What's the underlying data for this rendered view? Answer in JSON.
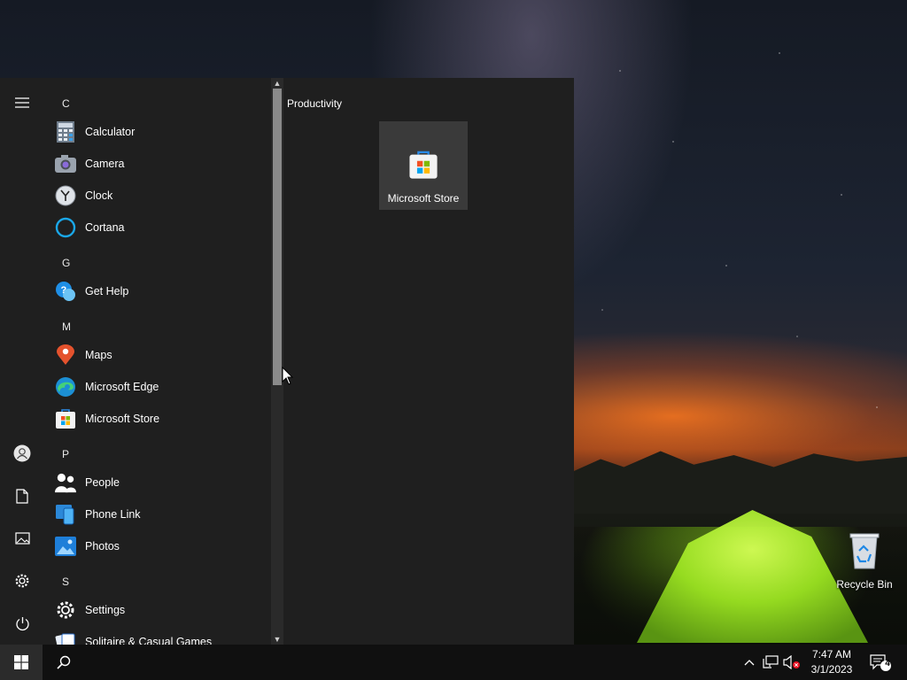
{
  "start_menu": {
    "app_list": [
      {
        "type": "letter",
        "text": "C"
      },
      {
        "type": "app",
        "label": "Calculator",
        "icon": "calculator-icon"
      },
      {
        "type": "app",
        "label": "Camera",
        "icon": "camera-icon"
      },
      {
        "type": "app",
        "label": "Clock",
        "icon": "clock-icon"
      },
      {
        "type": "app",
        "label": "Cortana",
        "icon": "cortana-icon"
      },
      {
        "type": "letter",
        "text": "G"
      },
      {
        "type": "app",
        "label": "Get Help",
        "icon": "get-help-icon"
      },
      {
        "type": "letter",
        "text": "M"
      },
      {
        "type": "app",
        "label": "Maps",
        "icon": "maps-icon"
      },
      {
        "type": "app",
        "label": "Microsoft Edge",
        "icon": "edge-icon"
      },
      {
        "type": "app",
        "label": "Microsoft Store",
        "icon": "store-icon"
      },
      {
        "type": "letter",
        "text": "P"
      },
      {
        "type": "app",
        "label": "People",
        "icon": "people-icon"
      },
      {
        "type": "app",
        "label": "Phone Link",
        "icon": "phone-link-icon"
      },
      {
        "type": "app",
        "label": "Photos",
        "icon": "photos-icon"
      },
      {
        "type": "letter",
        "text": "S"
      },
      {
        "type": "app",
        "label": "Settings",
        "icon": "gear-icon"
      },
      {
        "type": "app",
        "label": "Solitaire & Casual Games",
        "icon": "solitaire-icon"
      }
    ],
    "rail": [
      "hamburger-menu-icon",
      "user-icon",
      "documents-icon",
      "pictures-icon",
      "settings-icon",
      "power-icon"
    ],
    "tiles": {
      "group_title": "Productivity",
      "tile_label": "Microsoft Store"
    }
  },
  "desktop": {
    "recycle_bin_label": "Recycle Bin"
  },
  "taskbar": {
    "time": "7:47 AM",
    "date": "3/1/2023",
    "notification_count": "4"
  },
  "colors": {
    "menu_bg": "#1f1f1f",
    "tile_bg": "#3a3a3a",
    "taskbar_bg": "#101010"
  }
}
